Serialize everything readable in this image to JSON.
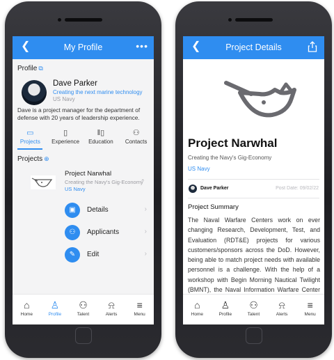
{
  "profile_screen": {
    "appbar": {
      "title": "My Profile",
      "back_icon": "chevron-left-icon",
      "more_label": "•••"
    },
    "section_profile": "Profile",
    "user": {
      "name": "Dave Parker",
      "tagline": "Creating the next marine technology",
      "org": "US Navy"
    },
    "bio": "Dave is a project manager for the department of defense with 20 years of leadership experience.",
    "tabs": [
      {
        "label": "Projects",
        "icon": "folder-icon",
        "active": true
      },
      {
        "label": "Experience",
        "icon": "id-badge-icon",
        "active": false
      },
      {
        "label": "Education",
        "icon": "books-icon",
        "active": false
      },
      {
        "label": "Contacts",
        "icon": "people-icon",
        "active": false
      }
    ],
    "section_projects": "Projects",
    "project": {
      "name": "Project Narwhal",
      "tagline": "Creating the Navy's Gig-Economy",
      "org": "US Navy"
    },
    "actions": [
      {
        "label": "Details",
        "icon": "briefcase-icon"
      },
      {
        "label": "Applicants",
        "icon": "people-icon"
      },
      {
        "label": "Edit",
        "icon": "edit-icon"
      }
    ],
    "nav": [
      {
        "label": "Home",
        "icon": "home-icon"
      },
      {
        "label": "Profile",
        "icon": "person-icon",
        "active": true
      },
      {
        "label": "Talent",
        "icon": "people-icon"
      },
      {
        "label": "Alerts",
        "icon": "bell-icon"
      },
      {
        "label": "Menu",
        "icon": "menu-icon"
      }
    ]
  },
  "details_screen": {
    "appbar": {
      "title": "Project Details",
      "back_icon": "chevron-left-icon",
      "share_icon": "share-icon"
    },
    "title": "Project Narwhal",
    "tagline": "Creating the Navy's Gig-Economy",
    "org": "US Navy",
    "author": "Dave Parker",
    "post_date": "Post Date: 09/02/22",
    "summary_heading": "Project Summary",
    "summary": "The Naval Warfare Centers work on ever changing Research, Development, Test, and Evaluation (RDT&E) projects for various customers/sponsors across the DoD. However, being able to match project needs with available personnel is a challenge. With the help of a workshop with Begin Morning Nautical Twilight (BMNT), the Naval Information Warfare Center Pacific (NIWC Pacific) have derived that the",
    "nav": [
      {
        "label": "Home",
        "icon": "home-icon"
      },
      {
        "label": "Profile",
        "icon": "person-icon"
      },
      {
        "label": "Talent",
        "icon": "people-icon"
      },
      {
        "label": "Alerts",
        "icon": "bell-icon"
      },
      {
        "label": "Menu",
        "icon": "menu-icon"
      }
    ]
  },
  "colors": {
    "accent": "#2f8df0",
    "muted": "#9a9aa0"
  }
}
